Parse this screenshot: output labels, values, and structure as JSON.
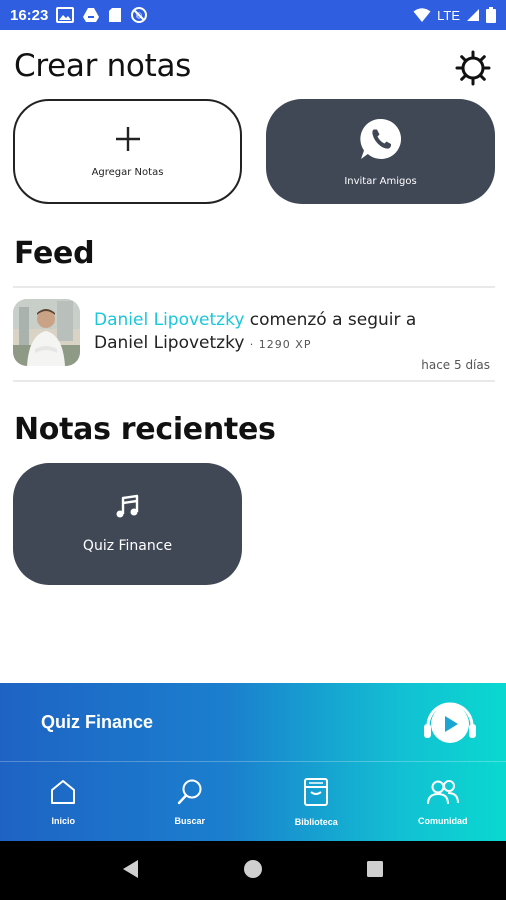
{
  "status_bar": {
    "time": "16:23",
    "network": "LTE"
  },
  "header": {
    "title": "Crear notas"
  },
  "actions": {
    "add_label": "Agregar Notas",
    "invite_label": "Invitar Amigos"
  },
  "feed": {
    "title": "Feed",
    "items": [
      {
        "actor": "Daniel Lipovetzky",
        "action": "comenzó a seguir a",
        "target": "Daniel Lipovetzky",
        "xp": "· 1290 XP",
        "time": "hace 5 días"
      }
    ]
  },
  "recent": {
    "title": "Notas recientes",
    "notes": [
      {
        "label": "Quiz Finance",
        "icon": "music-note-icon"
      }
    ]
  },
  "player": {
    "title": "Quiz Finance"
  },
  "nav": {
    "items": [
      {
        "label": "Inicio",
        "icon": "home-icon"
      },
      {
        "label": "Buscar",
        "icon": "search-icon"
      },
      {
        "label": "Biblioteca",
        "icon": "library-icon"
      },
      {
        "label": "Comunidad",
        "icon": "community-icon"
      }
    ]
  },
  "colors": {
    "status_bar": "#2f5fe0",
    "card_dark": "#404856",
    "accent_name": "#19c7db",
    "gradient_start": "#1e63c4",
    "gradient_end": "#0ad8d0"
  }
}
